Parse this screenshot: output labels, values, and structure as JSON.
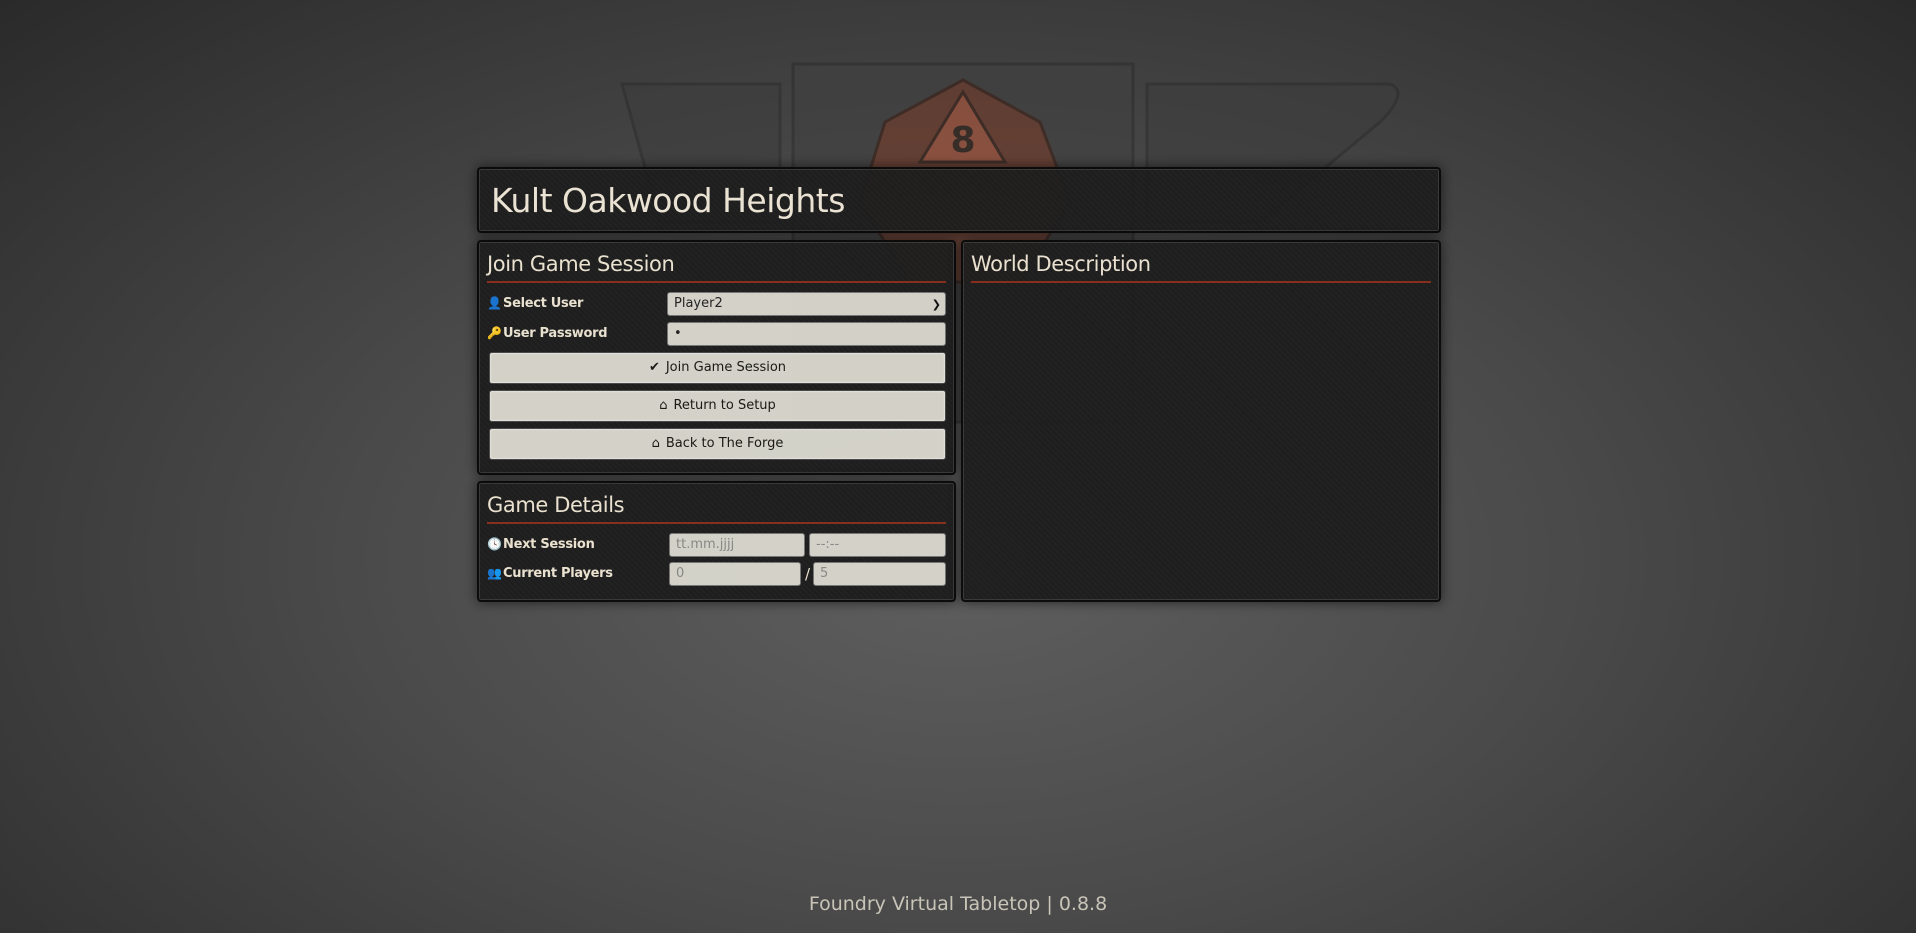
{
  "world": {
    "title": "Kult Oakwood Heights"
  },
  "join": {
    "heading": "Join Game Session",
    "select_user_label": "Select User",
    "selected_user": "Player2",
    "password_label": "User Password",
    "password_value": "•",
    "join_button": "Join Game Session",
    "setup_button": "Return to Setup",
    "forge_button": "Back to The Forge"
  },
  "details": {
    "heading": "Game Details",
    "next_session_label": "Next Session",
    "date_placeholder": "tt.mm.jjjj",
    "time_placeholder": "--:--",
    "players_label": "Current Players",
    "current_players": "0",
    "separator": "/",
    "max_players": "5"
  },
  "description": {
    "heading": "World Description"
  },
  "footer": {
    "text": "Foundry Virtual Tabletop | 0.8.8"
  },
  "icons": {
    "user": "user-icon",
    "key": "key-icon",
    "check": "check-icon",
    "home": "home-icon",
    "clock": "clock-icon",
    "users": "users-icon"
  },
  "colors": {
    "accent": "#8a2e1c",
    "panel": "#1d1d1d",
    "text": "#efe6d4",
    "field": "#d8d6cc"
  }
}
